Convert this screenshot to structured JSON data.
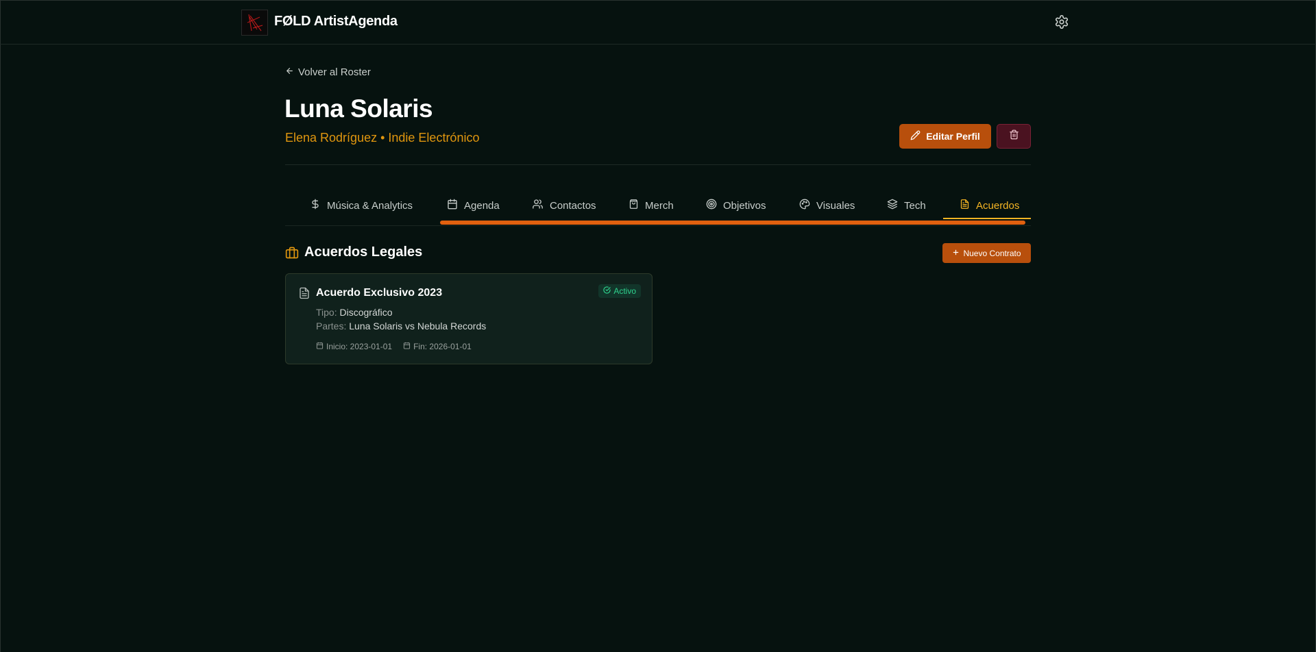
{
  "header": {
    "brand": "FØLD ArtistAgenda",
    "settings_icon": "gear-icon"
  },
  "nav": {
    "back_label": "Volver al Roster"
  },
  "artist": {
    "name": "Luna Solaris",
    "subtitle": "Elena Rodríguez • Indie Electrónico"
  },
  "actions": {
    "edit_label": "Editar Perfil",
    "delete_icon": "trash-icon"
  },
  "tabs": [
    {
      "label": "Música & Analytics",
      "icon": "dollar-icon"
    },
    {
      "label": "Agenda",
      "icon": "calendar-icon"
    },
    {
      "label": "Contactos",
      "icon": "users-icon"
    },
    {
      "label": "Merch",
      "icon": "shopping-bag-icon"
    },
    {
      "label": "Objetivos",
      "icon": "target-icon"
    },
    {
      "label": "Visuales",
      "icon": "palette-icon"
    },
    {
      "label": "Tech",
      "icon": "layers-icon"
    },
    {
      "label": "Acuerdos",
      "icon": "file-text-icon",
      "active": true
    }
  ],
  "section": {
    "title": "Acuerdos Legales",
    "new_label": "Nuevo Contrato"
  },
  "contracts": [
    {
      "title": "Acuerdo Exclusivo 2023",
      "status": "Activo",
      "tipo_label": "Tipo:",
      "tipo": "Discográfico",
      "partes_label": "Partes:",
      "partes": "Luna Solaris vs Nebula Records",
      "inicio": "Inicio: 2023-01-01",
      "fin": "Fin: 2026-01-01"
    }
  ],
  "colors": {
    "background": "#06120f",
    "accent": "#b84f0c",
    "active_tab": "#f5b524",
    "subtitle": "#e0960f",
    "status_active": "#2fd38e"
  }
}
